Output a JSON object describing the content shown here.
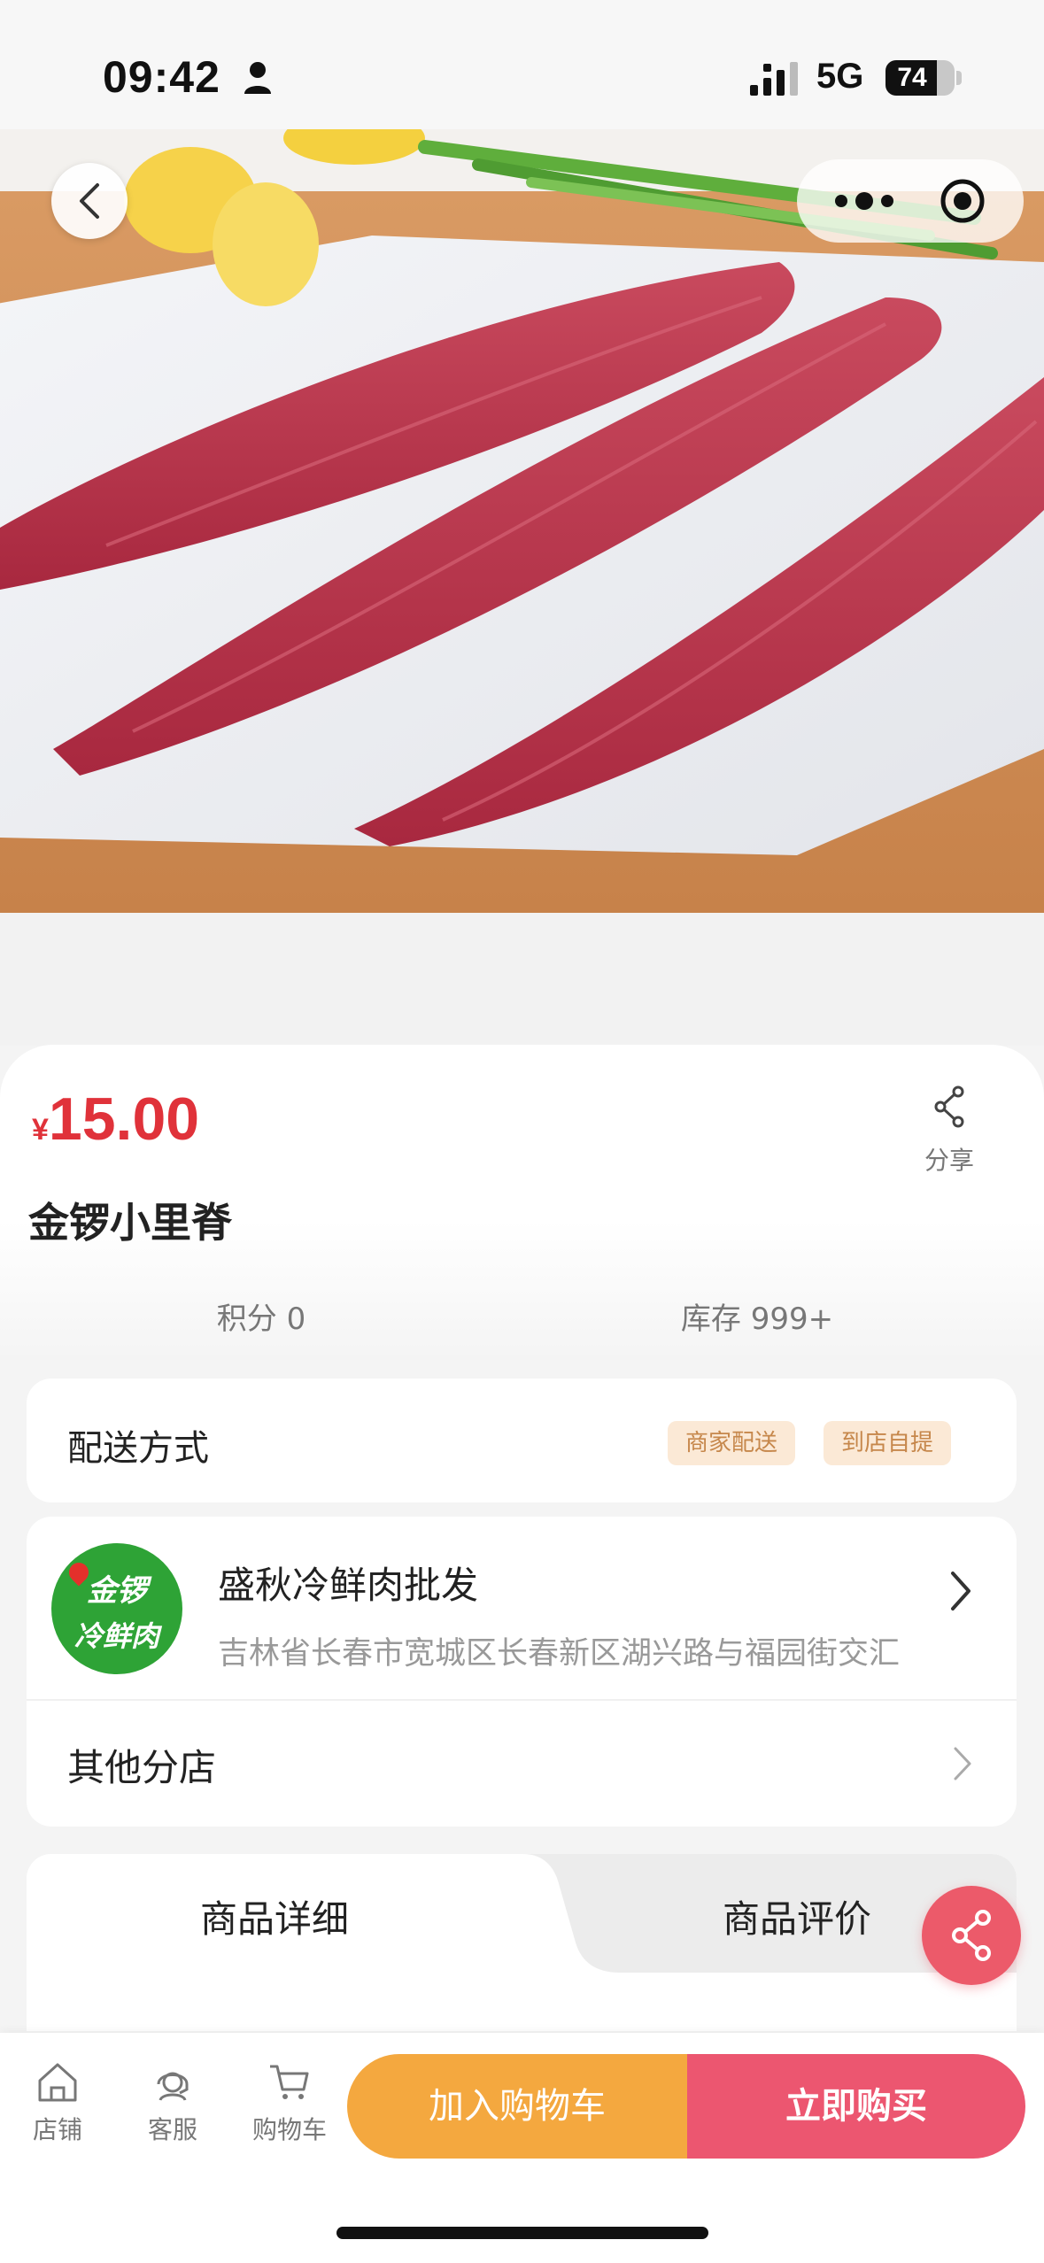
{
  "status_bar": {
    "time": "09:42",
    "network": "5G",
    "battery_percent": 74,
    "battery_label": "74"
  },
  "nav": {
    "back_icon": "chevron-left-icon",
    "more_icon": "more-dots-icon",
    "target_icon": "target-icon"
  },
  "product": {
    "currency_symbol": "¥",
    "price": "15.00",
    "name": "金锣小里脊",
    "share_label": "分享",
    "points": "积分 0",
    "stock": "库存 999+"
  },
  "delivery": {
    "label": "配送方式",
    "options": [
      "商家配送",
      "到店自提"
    ]
  },
  "store": {
    "logo_line1": "金锣",
    "logo_line2": "冷鲜肉",
    "name": "盛秋冷鲜肉批发",
    "address": "吉林省长春市宽城区长春新区湖兴路与福园街交汇",
    "branches_label": "其他分店"
  },
  "tabs": [
    {
      "label": "商品详细",
      "active": true
    },
    {
      "label": "商品评价",
      "active": false
    }
  ],
  "bottom_nav": {
    "items": [
      {
        "label": "店铺",
        "icon": "store-icon"
      },
      {
        "label": "客服",
        "icon": "customer-service-icon"
      },
      {
        "label": "购物车",
        "icon": "cart-icon"
      }
    ],
    "add_to_cart": "加入购物车",
    "buy_now": "立即购买"
  },
  "colors": {
    "price": "#e0323a",
    "add_to_cart": "#f4a83f",
    "buy_now": "#ec5670",
    "tag_bg": "#fbe9d6",
    "tag_text": "#c6874b",
    "logo_green": "#2ea336"
  }
}
